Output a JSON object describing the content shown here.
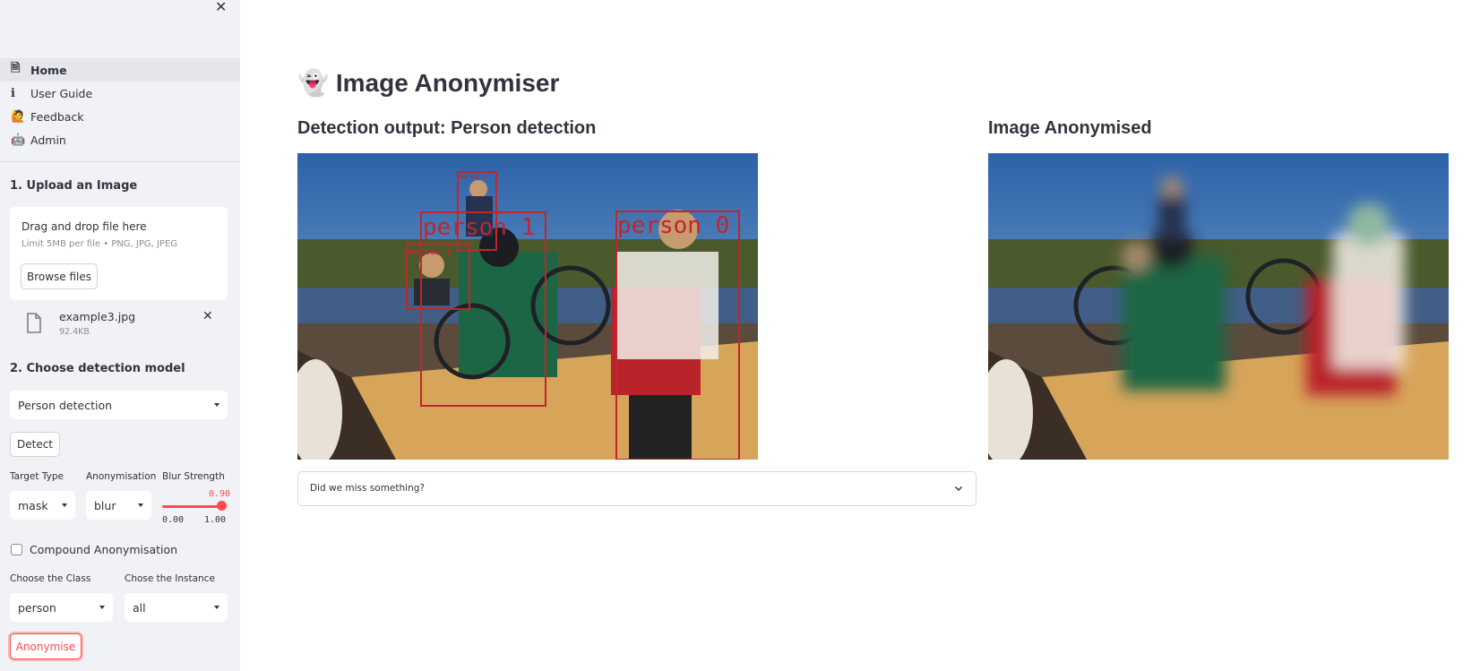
{
  "sidebar": {
    "nav": [
      {
        "label": "Home",
        "icon": "page-icon",
        "glyph": "🗎",
        "active": true
      },
      {
        "label": "User Guide",
        "icon": "info-icon",
        "glyph": "i",
        "active": false
      },
      {
        "label": "Feedback",
        "icon": "person-raising-hand-icon",
        "glyph": "🙋",
        "active": false
      },
      {
        "label": "Admin",
        "icon": "robot-icon",
        "glyph": "🤖",
        "active": false
      }
    ],
    "upload_title": "1. Upload an Image",
    "drop_text": "Drag and drop file here",
    "limit_text": "Limit 5MB per file • PNG, JPG, JPEG",
    "browse_label": "Browse files",
    "file_name": "example3.jpg",
    "file_size": "92.4KB",
    "model_title": "2. Choose detection model",
    "model_value": "Person detection",
    "detect_label": "Detect",
    "target_type_label": "Target Type",
    "target_type_value": "mask",
    "anon_label": "Anonymisation",
    "anon_value": "blur",
    "blur_label": "Blur Strength",
    "blur_value": "0.90",
    "blur_min": "0.00",
    "blur_max": "1.00",
    "compound_label": "Compound Anonymisation",
    "class_label": "Choose the Class",
    "class_value": "person",
    "instance_label": "Chose the Instance",
    "instance_value": "all",
    "anonymise_label": "Anonymise"
  },
  "main": {
    "title_emoji": "👻",
    "title": "Image Anonymiser",
    "detection_heading": "Detection output: Person detection",
    "anonymised_heading": "Image Anonymised",
    "expander_label": "Did we miss something?",
    "detections": [
      {
        "label": "person 0"
      },
      {
        "label": "person 1"
      },
      {
        "label": "person 2"
      },
      {
        "label": "person 3"
      }
    ]
  },
  "colors": {
    "accent": "#ff4b4b",
    "sidebar_bg": "#f0f2f6",
    "box": "#c0262b"
  }
}
